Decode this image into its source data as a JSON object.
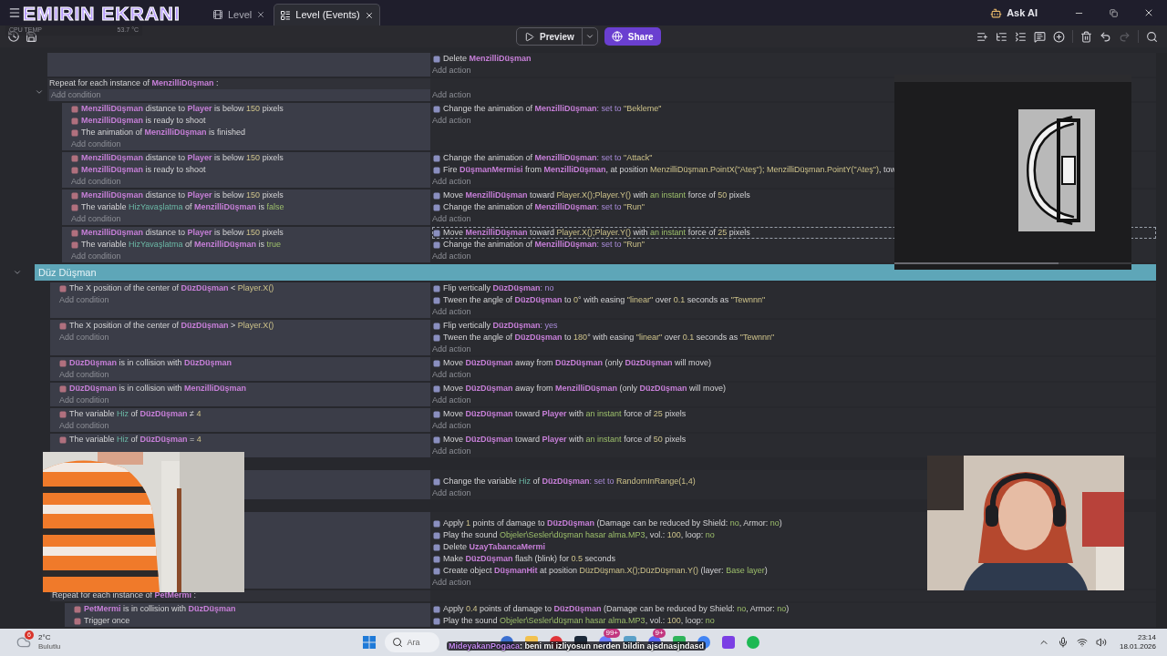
{
  "title_bar": {
    "overlay_title": "EMIRIN EKRANI",
    "tabs": [
      {
        "label": "Level",
        "selected": false,
        "kind": "scene"
      },
      {
        "label": "Level (Events)",
        "selected": true,
        "kind": "events"
      }
    ],
    "ask_ai": "Ask AI"
  },
  "sensor_overlay": {
    "label": "CPU TEMP",
    "value": "53.7 °C"
  },
  "toolbar": {
    "preview": "Preview",
    "share": "Share",
    "redo": {
      "disabled": true
    }
  },
  "events": [
    {
      "kind": "event",
      "actions": [
        {
          "selected": false,
          "parts": [
            {
              "kind": "text",
              "text": "Delete "
            },
            {
              "kind": "object",
              "text": "MenzilliDüşman"
            }
          ]
        }
      ],
      "add_action": "Add action"
    },
    {
      "kind": "repeat",
      "expanded": true,
      "header": [
        {
          "kind": "text",
          "text": "Repeat for each instance of "
        },
        {
          "kind": "object",
          "text": "MenzilliDüşman"
        },
        {
          "kind": "text",
          "text": " :"
        }
      ],
      "add_condition": "Add condition",
      "add_action": "Add action",
      "children": [
        {
          "kind": "event",
          "conditions": [
            [
              {
                "kind": "object",
                "text": "MenzilliDüşman"
              },
              {
                "kind": "text",
                "text": " distance to "
              },
              {
                "kind": "object",
                "text": "Player"
              },
              {
                "kind": "text",
                "text": " is below "
              },
              {
                "kind": "value",
                "text": "150"
              },
              {
                "kind": "text",
                "text": " pixels"
              }
            ],
            [
              {
                "kind": "object",
                "text": "MenzilliDüşman"
              },
              {
                "kind": "text",
                "text": " is ready to shoot"
              }
            ],
            [
              {
                "kind": "text",
                "text": "The animation of "
              },
              {
                "kind": "object",
                "text": "MenzilliDüşman"
              },
              {
                "kind": "text",
                "text": " is finished"
              }
            ]
          ],
          "add_condition": "Add condition",
          "actions": [
            {
              "selected": false,
              "parts": [
                {
                  "kind": "text",
                  "text": "Change the animation of "
                },
                {
                  "kind": "object",
                  "text": "MenzilliDüşman"
                },
                {
                  "kind": "keyword",
                  "text": ": set to "
                },
                {
                  "kind": "value",
                  "text": "\"Bekleme\""
                }
              ]
            }
          ],
          "add_action": "Add action"
        },
        {
          "kind": "event",
          "conditions": [
            [
              {
                "kind": "object",
                "text": "MenzilliDüşman"
              },
              {
                "kind": "text",
                "text": " distance to "
              },
              {
                "kind": "object",
                "text": "Player"
              },
              {
                "kind": "text",
                "text": " is below "
              },
              {
                "kind": "value",
                "text": "150"
              },
              {
                "kind": "text",
                "text": " pixels"
              }
            ],
            [
              {
                "kind": "object",
                "text": "MenzilliDüşman"
              },
              {
                "kind": "text",
                "text": " is ready to shoot"
              }
            ]
          ],
          "add_condition": "Add condition",
          "actions": [
            {
              "selected": false,
              "parts": [
                {
                  "kind": "text",
                  "text": "Change the animation of "
                },
                {
                  "kind": "object",
                  "text": "MenzilliDüşman"
                },
                {
                  "kind": "keyword",
                  "text": ": set to "
                },
                {
                  "kind": "value",
                  "text": "\"Attack\""
                }
              ]
            },
            {
              "selected": false,
              "parts": [
                {
                  "kind": "text",
                  "text": "Fire "
                },
                {
                  "kind": "object",
                  "text": "DüşmanMermisi"
                },
                {
                  "kind": "text",
                  "text": " from "
                },
                {
                  "kind": "object",
                  "text": "MenzilliDüşman"
                },
                {
                  "kind": "text",
                  "text": ", at position "
                },
                {
                  "kind": "value",
                  "text": "MenzilliDüşman.PointX(\"Ateş\"); MenzilliDüşman.PointY(\"Ateş\")"
                },
                {
                  "kind": "text",
                  "text": ", tow"
                }
              ]
            }
          ],
          "add_action": "Add action"
        },
        {
          "kind": "event",
          "conditions": [
            [
              {
                "kind": "object",
                "text": "MenzilliDüşman"
              },
              {
                "kind": "text",
                "text": " distance to "
              },
              {
                "kind": "object",
                "text": "Player"
              },
              {
                "kind": "text",
                "text": " is below "
              },
              {
                "kind": "value",
                "text": "150"
              },
              {
                "kind": "text",
                "text": " pixels"
              }
            ],
            [
              {
                "kind": "text",
                "text": "The variable "
              },
              {
                "kind": "variable",
                "text": "HizYavaşlatma"
              },
              {
                "kind": "text",
                "text": " of "
              },
              {
                "kind": "object",
                "text": "MenzilliDüşman"
              },
              {
                "kind": "text",
                "text": " is "
              },
              {
                "kind": "flag",
                "text": "false"
              }
            ]
          ],
          "add_condition": "Add condition",
          "actions": [
            {
              "selected": false,
              "parts": [
                {
                  "kind": "text",
                  "text": "Move "
                },
                {
                  "kind": "object",
                  "text": "MenzilliDüşman"
                },
                {
                  "kind": "text",
                  "text": " toward "
                },
                {
                  "kind": "value",
                  "text": "Player.X();Player.Y()"
                },
                {
                  "kind": "text",
                  "text": " with "
                },
                {
                  "kind": "flag",
                  "text": "an instant"
                },
                {
                  "kind": "text",
                  "text": " force of "
                },
                {
                  "kind": "value",
                  "text": "50"
                },
                {
                  "kind": "text",
                  "text": " pixels"
                }
              ]
            },
            {
              "selected": false,
              "parts": [
                {
                  "kind": "text",
                  "text": "Change the animation of "
                },
                {
                  "kind": "object",
                  "text": "MenzilliDüşman"
                },
                {
                  "kind": "keyword",
                  "text": ": set to "
                },
                {
                  "kind": "value",
                  "text": "\"Run\""
                }
              ]
            }
          ],
          "add_action": "Add action"
        },
        {
          "kind": "event",
          "conditions": [
            [
              {
                "kind": "object",
                "text": "MenzilliDüşman"
              },
              {
                "kind": "text",
                "text": " distance to "
              },
              {
                "kind": "object",
                "text": "Player"
              },
              {
                "kind": "text",
                "text": " is below "
              },
              {
                "kind": "value",
                "text": "150"
              },
              {
                "kind": "text",
                "text": " pixels"
              }
            ],
            [
              {
                "kind": "text",
                "text": "The variable "
              },
              {
                "kind": "variable",
                "text": "HizYavaşlatma"
              },
              {
                "kind": "text",
                "text": " of "
              },
              {
                "kind": "object",
                "text": "MenzilliDüşman"
              },
              {
                "kind": "text",
                "text": " is "
              },
              {
                "kind": "flag",
                "text": "true"
              }
            ]
          ],
          "add_condition": "Add condition",
          "actions": [
            {
              "selected": true,
              "parts": [
                {
                  "kind": "text",
                  "text": "Move "
                },
                {
                  "kind": "object",
                  "text": "MenzilliDüşman"
                },
                {
                  "kind": "text",
                  "text": " toward "
                },
                {
                  "kind": "value",
                  "text": "Player.X();Player.Y()"
                },
                {
                  "kind": "text",
                  "text": " with "
                },
                {
                  "kind": "flag",
                  "text": "an instant"
                },
                {
                  "kind": "text",
                  "text": " force of "
                },
                {
                  "kind": "value",
                  "text": "25"
                },
                {
                  "kind": "text",
                  "text": " pixels"
                }
              ]
            },
            {
              "selected": false,
              "parts": [
                {
                  "kind": "text",
                  "text": "Change the animation of "
                },
                {
                  "kind": "object",
                  "text": "MenzilliDüşman"
                },
                {
                  "kind": "keyword",
                  "text": ": set to "
                },
                {
                  "kind": "value",
                  "text": "\"Run\""
                }
              ]
            }
          ],
          "add_action": "Add action"
        }
      ]
    },
    {
      "kind": "group",
      "expanded": true,
      "title": "Düz Düşman",
      "children": [
        {
          "kind": "event",
          "conditions": [
            [
              {
                "kind": "text",
                "text": "The X position of the center of "
              },
              {
                "kind": "object",
                "text": "DüzDüşman"
              },
              {
                "kind": "text",
                "text": " < "
              },
              {
                "kind": "value",
                "text": "Player.X()"
              }
            ]
          ],
          "add_condition": "Add condition",
          "actions": [
            {
              "selected": false,
              "parts": [
                {
                  "kind": "text",
                  "text": "Flip vertically "
                },
                {
                  "kind": "object",
                  "text": "DüzDüşman"
                },
                {
                  "kind": "keyword",
                  "text": ": no"
                }
              ]
            },
            {
              "selected": false,
              "parts": [
                {
                  "kind": "text",
                  "text": "Tween the angle of "
                },
                {
                  "kind": "object",
                  "text": "DüzDüşman"
                },
                {
                  "kind": "text",
                  "text": " to "
                },
                {
                  "kind": "value",
                  "text": "0"
                },
                {
                  "kind": "text",
                  "text": "° with easing "
                },
                {
                  "kind": "value",
                  "text": "\"linear\""
                },
                {
                  "kind": "text",
                  "text": " over "
                },
                {
                  "kind": "value",
                  "text": "0.1"
                },
                {
                  "kind": "text",
                  "text": " seconds as "
                },
                {
                  "kind": "value",
                  "text": "\"Tewnnn\""
                }
              ]
            }
          ],
          "add_action": "Add action"
        },
        {
          "kind": "event",
          "conditions": [
            [
              {
                "kind": "text",
                "text": "The X position of the center of "
              },
              {
                "kind": "object",
                "text": "DüzDüşman"
              },
              {
                "kind": "text",
                "text": " > "
              },
              {
                "kind": "value",
                "text": "Player.X()"
              }
            ]
          ],
          "add_condition": "Add condition",
          "actions": [
            {
              "selected": false,
              "parts": [
                {
                  "kind": "text",
                  "text": "Flip vertically "
                },
                {
                  "kind": "object",
                  "text": "DüzDüşman"
                },
                {
                  "kind": "keyword",
                  "text": ": yes"
                }
              ]
            },
            {
              "selected": false,
              "parts": [
                {
                  "kind": "text",
                  "text": "Tween the angle of "
                },
                {
                  "kind": "object",
                  "text": "DüzDüşman"
                },
                {
                  "kind": "text",
                  "text": " to "
                },
                {
                  "kind": "value",
                  "text": "180"
                },
                {
                  "kind": "text",
                  "text": "° with easing "
                },
                {
                  "kind": "value",
                  "text": "\"linear\""
                },
                {
                  "kind": "text",
                  "text": " over "
                },
                {
                  "kind": "value",
                  "text": "0.1"
                },
                {
                  "kind": "text",
                  "text": " seconds as "
                },
                {
                  "kind": "value",
                  "text": "\"Tewnnn\""
                }
              ]
            }
          ],
          "add_action": "Add action"
        },
        {
          "kind": "event",
          "conditions": [
            [
              {
                "kind": "object",
                "text": "DüzDüşman"
              },
              {
                "kind": "text",
                "text": " is in collision with "
              },
              {
                "kind": "object",
                "text": "DüzDüşman"
              }
            ]
          ],
          "add_condition": "Add condition",
          "actions": [
            {
              "selected": false,
              "parts": [
                {
                  "kind": "text",
                  "text": "Move "
                },
                {
                  "kind": "object",
                  "text": "DüzDüşman"
                },
                {
                  "kind": "text",
                  "text": " away from "
                },
                {
                  "kind": "object",
                  "text": "DüzDüşman"
                },
                {
                  "kind": "text",
                  "text": " (only "
                },
                {
                  "kind": "object",
                  "text": "DüzDüşman"
                },
                {
                  "kind": "text",
                  "text": " will move)"
                }
              ]
            }
          ],
          "add_action": "Add action"
        },
        {
          "kind": "event",
          "conditions": [
            [
              {
                "kind": "object",
                "text": "DüzDüşman"
              },
              {
                "kind": "text",
                "text": " is in collision with "
              },
              {
                "kind": "object",
                "text": "MenzilliDüşman"
              }
            ]
          ],
          "add_condition": "Add condition",
          "actions": [
            {
              "selected": false,
              "parts": [
                {
                  "kind": "text",
                  "text": "Move "
                },
                {
                  "kind": "object",
                  "text": "DüzDüşman"
                },
                {
                  "kind": "text",
                  "text": " away from "
                },
                {
                  "kind": "object",
                  "text": "MenzilliDüşman"
                },
                {
                  "kind": "text",
                  "text": " (only "
                },
                {
                  "kind": "object",
                  "text": "DüzDüşman"
                },
                {
                  "kind": "text",
                  "text": " will move)"
                }
              ]
            }
          ],
          "add_action": "Add action"
        },
        {
          "kind": "event",
          "conditions": [
            [
              {
                "kind": "text",
                "text": "The variable "
              },
              {
                "kind": "variable",
                "text": "Hiz"
              },
              {
                "kind": "text",
                "text": " of "
              },
              {
                "kind": "object",
                "text": "DüzDüşman"
              },
              {
                "kind": "text",
                "text": " ≠ "
              },
              {
                "kind": "value",
                "text": "4"
              }
            ]
          ],
          "add_condition": "Add condition",
          "actions": [
            {
              "selected": false,
              "parts": [
                {
                  "kind": "text",
                  "text": "Move "
                },
                {
                  "kind": "object",
                  "text": "DüzDüşman"
                },
                {
                  "kind": "text",
                  "text": " toward "
                },
                {
                  "kind": "object",
                  "text": "Player"
                },
                {
                  "kind": "text",
                  "text": " with "
                },
                {
                  "kind": "flag",
                  "text": "an instant"
                },
                {
                  "kind": "text",
                  "text": " force of "
                },
                {
                  "kind": "value",
                  "text": "25"
                },
                {
                  "kind": "text",
                  "text": " pixels"
                }
              ]
            }
          ],
          "add_action": "Add action"
        },
        {
          "kind": "event",
          "conditions": [
            [
              {
                "kind": "text",
                "text": "The variable "
              },
              {
                "kind": "variable",
                "text": "Hiz"
              },
              {
                "kind": "text",
                "text": " of "
              },
              {
                "kind": "object",
                "text": "DüzDüşman"
              },
              {
                "kind": "text",
                "text": " = "
              },
              {
                "kind": "value",
                "text": "4"
              }
            ]
          ],
          "actions": [
            {
              "selected": false,
              "parts": [
                {
                  "kind": "text",
                  "text": "Move "
                },
                {
                  "kind": "object",
                  "text": "DüzDüşman"
                },
                {
                  "kind": "text",
                  "text": " toward "
                },
                {
                  "kind": "object",
                  "text": "Player"
                },
                {
                  "kind": "text",
                  "text": " with "
                },
                {
                  "kind": "flag",
                  "text": "an instant"
                },
                {
                  "kind": "text",
                  "text": " force of "
                },
                {
                  "kind": "value",
                  "text": "50"
                },
                {
                  "kind": "text",
                  "text": " pixels"
                }
              ]
            }
          ],
          "add_action": "Add action"
        },
        {
          "kind": "event",
          "actions": [
            {
              "selected": false,
              "parts": [
                {
                  "kind": "text",
                  "text": "Change the variable "
                },
                {
                  "kind": "variable",
                  "text": "Hiz"
                },
                {
                  "kind": "text",
                  "text": " of "
                },
                {
                  "kind": "object",
                  "text": "DüzDüşman"
                },
                {
                  "kind": "keyword",
                  "text": ": set to "
                },
                {
                  "kind": "value",
                  "text": "RandomInRange(1,4)"
                }
              ]
            }
          ],
          "add_action": "Add action"
        },
        {
          "kind": "event",
          "actions": [
            {
              "selected": false,
              "parts": [
                {
                  "kind": "text",
                  "text": "Apply "
                },
                {
                  "kind": "value",
                  "text": "1"
                },
                {
                  "kind": "text",
                  "text": " points of damage to "
                },
                {
                  "kind": "object",
                  "text": "DüzDüşman"
                },
                {
                  "kind": "text",
                  "text": " (Damage can be reduced by Shield: "
                },
                {
                  "kind": "flag",
                  "text": "no"
                },
                {
                  "kind": "text",
                  "text": ", Armor: "
                },
                {
                  "kind": "flag",
                  "text": "no"
                },
                {
                  "kind": "text",
                  "text": ")"
                }
              ]
            },
            {
              "selected": false,
              "parts": [
                {
                  "kind": "text",
                  "text": "Play the sound "
                },
                {
                  "kind": "flag",
                  "text": "Objeler\\Sesler\\düşman hasar alma.MP3"
                },
                {
                  "kind": "text",
                  "text": ", vol.: "
                },
                {
                  "kind": "value",
                  "text": "100"
                },
                {
                  "kind": "text",
                  "text": ", loop: "
                },
                {
                  "kind": "flag",
                  "text": "no"
                }
              ]
            },
            {
              "selected": false,
              "parts": [
                {
                  "kind": "text",
                  "text": "Delete "
                },
                {
                  "kind": "object",
                  "text": "UzayTabancaMermi"
                }
              ]
            },
            {
              "selected": false,
              "parts": [
                {
                  "kind": "text",
                  "text": "Make "
                },
                {
                  "kind": "object",
                  "text": "DüzDüşman"
                },
                {
                  "kind": "text",
                  "text": " flash (blink) for "
                },
                {
                  "kind": "value",
                  "text": "0.5"
                },
                {
                  "kind": "text",
                  "text": " seconds"
                }
              ]
            },
            {
              "selected": false,
              "parts": [
                {
                  "kind": "text",
                  "text": "Create object "
                },
                {
                  "kind": "object",
                  "text": "DüşmanHit"
                },
                {
                  "kind": "text",
                  "text": " at position "
                },
                {
                  "kind": "value",
                  "text": "DüzDüşman.X();DüzDüşman.Y()"
                },
                {
                  "kind": "text",
                  "text": " (layer: "
                },
                {
                  "kind": "flag",
                  "text": "Base layer"
                },
                {
                  "kind": "text",
                  "text": ")"
                }
              ]
            }
          ],
          "add_action": "Add action"
        },
        {
          "kind": "repeat",
          "header": [
            {
              "kind": "text",
              "text": "Repeat for each instance of "
            },
            {
              "kind": "object",
              "text": "PetMermi"
            },
            {
              "kind": "text",
              "text": " :"
            }
          ],
          "children": [
            {
              "kind": "event",
              "conditions": [
                [
                  {
                    "kind": "object",
                    "text": "PetMermi"
                  },
                  {
                    "kind": "text",
                    "text": " is in collision with "
                  },
                  {
                    "kind": "object",
                    "text": "DüzDüşman"
                  }
                ],
                [
                  {
                    "kind": "text",
                    "text": "Trigger once"
                  }
                ]
              ],
              "actions": [
                {
                  "selected": false,
                  "parts": [
                    {
                      "kind": "text",
                      "text": "Apply "
                    },
                    {
                      "kind": "value",
                      "text": "0.4"
                    },
                    {
                      "kind": "text",
                      "text": " points of damage to "
                    },
                    {
                      "kind": "object",
                      "text": "DüzDüşman"
                    },
                    {
                      "kind": "text",
                      "text": " (Damage can be reduced by Shield: "
                    },
                    {
                      "kind": "flag",
                      "text": "no"
                    },
                    {
                      "kind": "text",
                      "text": ", Armor: "
                    },
                    {
                      "kind": "flag",
                      "text": "no"
                    },
                    {
                      "kind": "text",
                      "text": ")"
                    }
                  ]
                },
                {
                  "selected": false,
                  "parts": [
                    {
                      "kind": "text",
                      "text": "Play the sound "
                    },
                    {
                      "kind": "flag",
                      "text": "Objeler\\Sesler\\düşman hasar alma.MP3"
                    },
                    {
                      "kind": "text",
                      "text": ", vol.: "
                    },
                    {
                      "kind": "value",
                      "text": "100"
                    },
                    {
                      "kind": "text",
                      "text": ", loop: "
                    },
                    {
                      "kind": "flag",
                      "text": "no"
                    }
                  ]
                }
              ]
            }
          ]
        }
      ]
    }
  ],
  "taskbar": {
    "notification_count": "6",
    "temperature": "2°C",
    "weather": "Bulutlu",
    "search_placeholder": "Ara",
    "badges": [
      "99+",
      "9+"
    ],
    "time": "23:14",
    "date": "18.01.2026"
  },
  "chat_overlay": {
    "user": "MideyakanPogaca",
    "message": ": beni mi izliyosun nerden bildin ajsdnasjndasd"
  }
}
